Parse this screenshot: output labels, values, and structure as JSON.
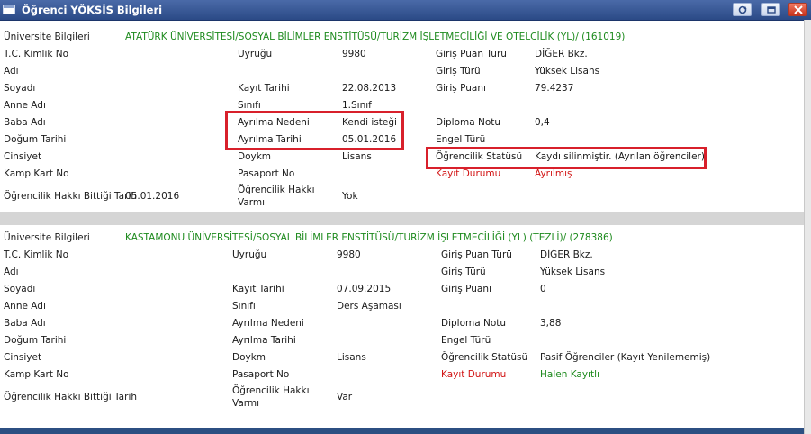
{
  "window": {
    "title": "Öğrenci YÖKSİS Bilgileri"
  },
  "labels": {
    "universite": "Üniversite Bilgileri",
    "tc": "T.C. Kimlik No",
    "adi": "Adı",
    "soyadi": "Soyadı",
    "anne": "Anne Adı",
    "baba": "Baba Adı",
    "dogum": "Doğum Tarihi",
    "cinsiyet": "Cinsiyet",
    "kamp": "Kamp Kart No",
    "hak_bitti": "Öğrencilik Hakkı Bittiği Tarih",
    "uyrugu": "Uyruğu",
    "kayit_tarihi": "Kayıt Tarihi",
    "sinifi": "Sınıfı",
    "ayrilma_nedeni": "Ayrılma Nedeni",
    "ayrilma_tarihi": "Ayrılma Tarihi",
    "doykm": "Doykm",
    "pasaport": "Pasaport No",
    "hak_varmi_1": "Öğrencilik Hakkı",
    "hak_varmi_2": "Varmı",
    "giris_puan_turu": "Giriş Puan Türü",
    "giris_turu": "Giriş Türü",
    "giris_puani": "Giriş Puanı",
    "diploma_notu": "Diploma Notu",
    "engel_turu": "Engel Türü",
    "statusu": "Öğrencilik Statüsü",
    "kayit_durumu": "Kayıt Durumu"
  },
  "records": [
    {
      "university": "ATATÜRK ÜNİVERSİTESİ/SOSYAL BİLİMLER ENSTİTÜSÜ/TURİZM İŞLETMECİLİĞİ VE OTELCİLİK (YL)/ (161019)",
      "hak_bitti": "05.01.2016",
      "uyrugu": "9980",
      "kayit_tarihi": "22.08.2013",
      "sinifi": "1.Sınıf",
      "ayrilma_nedeni": "Kendi isteği",
      "ayrilma_tarihi": "05.01.2016",
      "doykm": "Lisans",
      "hak_varmi": "Yok",
      "giris_puan_turu": "DİĞER Bkz.",
      "giris_turu": "Yüksek Lisans",
      "giris_puani": "79.4237",
      "diploma_notu": "0,4",
      "statusu": "Kaydı silinmiştir. (Ayrılan öğrenciler)",
      "kayit_durumu": "Ayrılmış"
    },
    {
      "university": "KASTAMONU ÜNİVERSİTESİ/SOSYAL BİLİMLER ENSTİTÜSÜ/TURİZM İŞLETMECİLİĞİ (YL) (TEZLİ)/ (278386)",
      "uyrugu": "9980",
      "kayit_tarihi": "07.09.2015",
      "sinifi": "Ders Aşaması",
      "doykm": "Lisans",
      "hak_varmi": "Var",
      "giris_puan_turu": "DİĞER Bkz.",
      "giris_turu": "Yüksek Lisans",
      "giris_puani": "0",
      "diploma_notu": "3,88",
      "statusu": "Pasif Öğrenciler (Kayıt Yenilememiş)",
      "kayit_durumu": "Halen Kayıtlı"
    }
  ],
  "colors": {
    "highlight": "#d8202b",
    "university": "#1d8a1d",
    "alert": "#d21414",
    "titlebar": "#2b4a86"
  }
}
